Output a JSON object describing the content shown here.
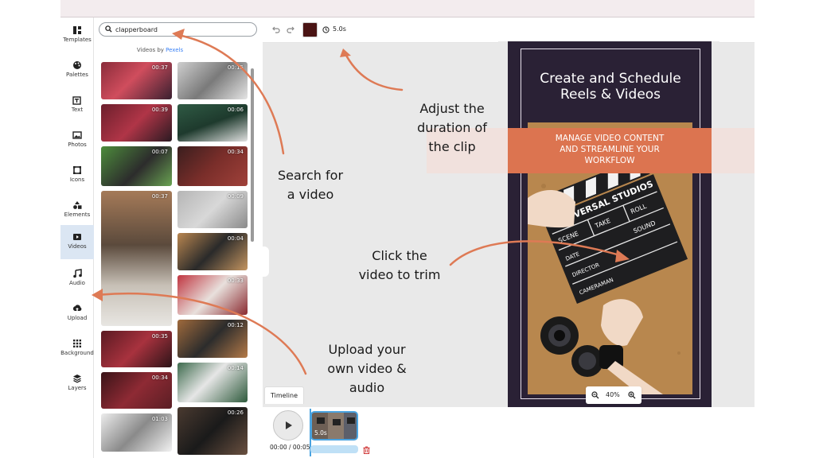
{
  "app": {
    "accent": "#dc7450",
    "active_tab_bg": "#dbe6f3"
  },
  "rail": {
    "items": [
      {
        "label": "Templates",
        "icon": "templates-icon"
      },
      {
        "label": "Palettes",
        "icon": "palette-icon"
      },
      {
        "label": "Text",
        "icon": "text-icon"
      },
      {
        "label": "Photos",
        "icon": "photo-icon"
      },
      {
        "label": "Icons",
        "icon": "icons-icon"
      },
      {
        "label": "Elements",
        "icon": "elements-icon"
      },
      {
        "label": "Videos",
        "icon": "video-icon",
        "active": true
      },
      {
        "label": "Audio",
        "icon": "music-icon"
      },
      {
        "label": "Upload",
        "icon": "upload-icon"
      },
      {
        "label": "Background",
        "icon": "grid-icon"
      },
      {
        "label": "Layers",
        "icon": "layers-icon"
      }
    ]
  },
  "panel": {
    "search_value": "clapperboard",
    "credit_prefix": "Videos by ",
    "credit_link": "Pexels",
    "videos": [
      {
        "duration": "00:37"
      },
      {
        "duration": "00:15"
      },
      {
        "duration": "00:39"
      },
      {
        "duration": "00:06"
      },
      {
        "duration": "00:07"
      },
      {
        "duration": "00:34"
      },
      {
        "duration": "00:37"
      },
      {
        "duration": "00:09"
      },
      {
        "duration": "00:04"
      },
      {
        "duration": "00:33"
      },
      {
        "duration": "00:35"
      },
      {
        "duration": "00:12"
      },
      {
        "duration": "00:34"
      },
      {
        "duration": "00:14"
      },
      {
        "duration": "01:03"
      },
      {
        "duration": "00:26"
      }
    ]
  },
  "toolbar": {
    "duration": "5.0s",
    "swatch_color": "#4a1414"
  },
  "poster": {
    "title_line1": "Create and Schedule",
    "title_line2": "Reels & Videos",
    "band_line1": "MANAGE VIDEO CONTENT",
    "band_line2": "AND STREAMLINE YOUR",
    "band_line3": "WORKFLOW",
    "clapper_line1": "UNIVERSAL STUDIOS",
    "scene": "SCENE",
    "take": "TAKE",
    "roll": "ROLL",
    "sound": "SOUND",
    "date": "DATE",
    "director": "DIRECTOR",
    "camera": "CAMERAMAN"
  },
  "zoom": {
    "level": "40%"
  },
  "timeline": {
    "tab_label": "Timeline",
    "time": "00:00 / 00:05",
    "clip_duration": "5.0s"
  },
  "annotations": {
    "search_1": "Search for",
    "search_2": "a video",
    "duration_1": "Adjust the",
    "duration_2": "duration of",
    "duration_3": "the clip",
    "trim_1": "Click the",
    "trim_2": "video to trim",
    "upload_1": "Upload your",
    "upload_2": "own video &",
    "upload_3": "audio"
  }
}
